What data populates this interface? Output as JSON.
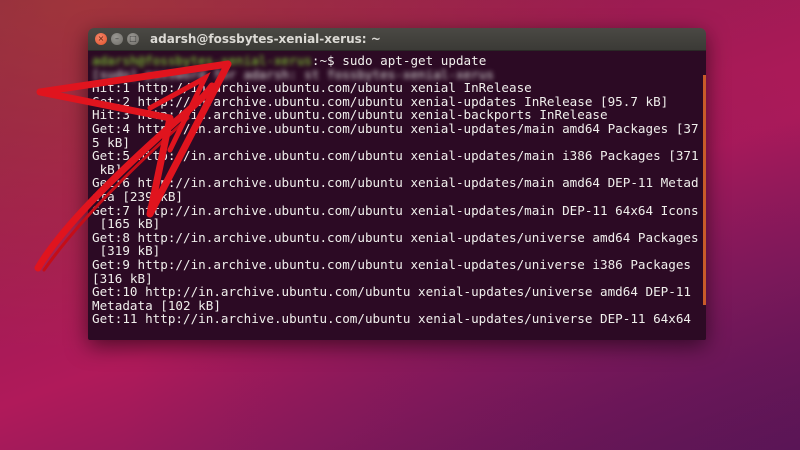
{
  "window": {
    "title": "adarsh@fossbytes-xenial-xerus: ~",
    "close_glyph": "×",
    "min_glyph": "–",
    "max_glyph": "□"
  },
  "terminal": {
    "prompt_user": "adarsh@fossbytes-xenial-xerus",
    "prompt_path": ":~$ ",
    "command": "sudo apt-get update",
    "lines": [
      "[sudo] password for adarsh: st fossbytes-xenial-xerus",
      "Hit:1 http://in.archive.ubuntu.com/ubuntu xenial InRelease",
      "Get:2 http://in.archive.ubuntu.com/ubuntu xenial-updates InRelease [95.7 kB]",
      "Hit:3 http://in.archive.ubuntu.com/ubuntu xenial-backports InRelease",
      "Get:4 http://in.archive.ubuntu.com/ubuntu xenial-updates/main amd64 Packages [37",
      "5 kB]",
      "Get:5 http://in.archive.ubuntu.com/ubuntu xenial-updates/main i386 Packages [371",
      " kB]",
      "Get:6 http://in.archive.ubuntu.com/ubuntu xenial-updates/main amd64 DEP-11 Metad",
      "ata [239 kB]",
      "Get:7 http://in.archive.ubuntu.com/ubuntu xenial-updates/main DEP-11 64x64 Icons",
      " [165 kB]",
      "Get:8 http://in.archive.ubuntu.com/ubuntu xenial-updates/universe amd64 Packages",
      " [319 kB]",
      "Get:9 http://in.archive.ubuntu.com/ubuntu xenial-updates/universe i386 Packages",
      "[316 kB]",
      "Get:10 http://in.archive.ubuntu.com/ubuntu xenial-updates/universe amd64 DEP-11",
      "Metadata [102 kB]",
      "Get:11 http://in.archive.ubuntu.com/ubuntu xenial-updates/universe DEP-11 64x64"
    ]
  },
  "colors": {
    "terminal_bg": "#2c0a24",
    "terminal_fg": "#f0efec",
    "prompt_green": "#8ae234",
    "arrow_red": "#e0141e"
  }
}
